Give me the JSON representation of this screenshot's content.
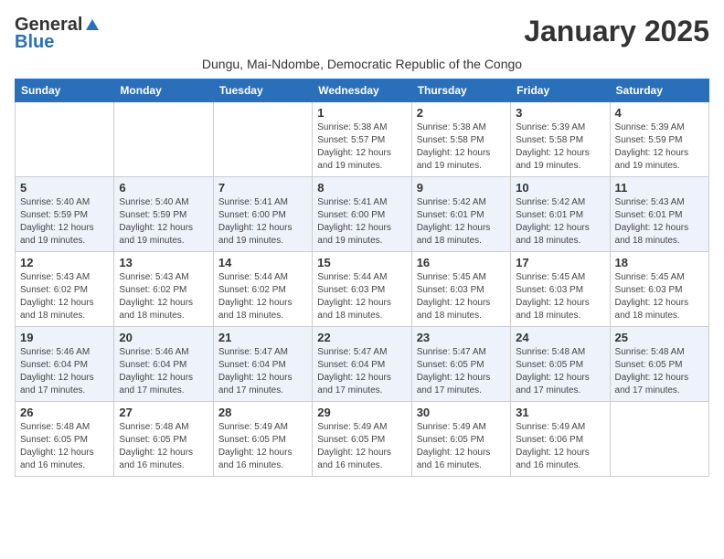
{
  "logo": {
    "line1": "General",
    "line2": "Blue"
  },
  "title": "January 2025",
  "subtitle": "Dungu, Mai-Ndombe, Democratic Republic of the Congo",
  "days_of_week": [
    "Sunday",
    "Monday",
    "Tuesday",
    "Wednesday",
    "Thursday",
    "Friday",
    "Saturday"
  ],
  "weeks": [
    [
      {
        "day": "",
        "info": ""
      },
      {
        "day": "",
        "info": ""
      },
      {
        "day": "",
        "info": ""
      },
      {
        "day": "1",
        "info": "Sunrise: 5:38 AM\nSunset: 5:57 PM\nDaylight: 12 hours and 19 minutes."
      },
      {
        "day": "2",
        "info": "Sunrise: 5:38 AM\nSunset: 5:58 PM\nDaylight: 12 hours and 19 minutes."
      },
      {
        "day": "3",
        "info": "Sunrise: 5:39 AM\nSunset: 5:58 PM\nDaylight: 12 hours and 19 minutes."
      },
      {
        "day": "4",
        "info": "Sunrise: 5:39 AM\nSunset: 5:59 PM\nDaylight: 12 hours and 19 minutes."
      }
    ],
    [
      {
        "day": "5",
        "info": "Sunrise: 5:40 AM\nSunset: 5:59 PM\nDaylight: 12 hours and 19 minutes."
      },
      {
        "day": "6",
        "info": "Sunrise: 5:40 AM\nSunset: 5:59 PM\nDaylight: 12 hours and 19 minutes."
      },
      {
        "day": "7",
        "info": "Sunrise: 5:41 AM\nSunset: 6:00 PM\nDaylight: 12 hours and 19 minutes."
      },
      {
        "day": "8",
        "info": "Sunrise: 5:41 AM\nSunset: 6:00 PM\nDaylight: 12 hours and 19 minutes."
      },
      {
        "day": "9",
        "info": "Sunrise: 5:42 AM\nSunset: 6:01 PM\nDaylight: 12 hours and 18 minutes."
      },
      {
        "day": "10",
        "info": "Sunrise: 5:42 AM\nSunset: 6:01 PM\nDaylight: 12 hours and 18 minutes."
      },
      {
        "day": "11",
        "info": "Sunrise: 5:43 AM\nSunset: 6:01 PM\nDaylight: 12 hours and 18 minutes."
      }
    ],
    [
      {
        "day": "12",
        "info": "Sunrise: 5:43 AM\nSunset: 6:02 PM\nDaylight: 12 hours and 18 minutes."
      },
      {
        "day": "13",
        "info": "Sunrise: 5:43 AM\nSunset: 6:02 PM\nDaylight: 12 hours and 18 minutes."
      },
      {
        "day": "14",
        "info": "Sunrise: 5:44 AM\nSunset: 6:02 PM\nDaylight: 12 hours and 18 minutes."
      },
      {
        "day": "15",
        "info": "Sunrise: 5:44 AM\nSunset: 6:03 PM\nDaylight: 12 hours and 18 minutes."
      },
      {
        "day": "16",
        "info": "Sunrise: 5:45 AM\nSunset: 6:03 PM\nDaylight: 12 hours and 18 minutes."
      },
      {
        "day": "17",
        "info": "Sunrise: 5:45 AM\nSunset: 6:03 PM\nDaylight: 12 hours and 18 minutes."
      },
      {
        "day": "18",
        "info": "Sunrise: 5:45 AM\nSunset: 6:03 PM\nDaylight: 12 hours and 18 minutes."
      }
    ],
    [
      {
        "day": "19",
        "info": "Sunrise: 5:46 AM\nSunset: 6:04 PM\nDaylight: 12 hours and 17 minutes."
      },
      {
        "day": "20",
        "info": "Sunrise: 5:46 AM\nSunset: 6:04 PM\nDaylight: 12 hours and 17 minutes."
      },
      {
        "day": "21",
        "info": "Sunrise: 5:47 AM\nSunset: 6:04 PM\nDaylight: 12 hours and 17 minutes."
      },
      {
        "day": "22",
        "info": "Sunrise: 5:47 AM\nSunset: 6:04 PM\nDaylight: 12 hours and 17 minutes."
      },
      {
        "day": "23",
        "info": "Sunrise: 5:47 AM\nSunset: 6:05 PM\nDaylight: 12 hours and 17 minutes."
      },
      {
        "day": "24",
        "info": "Sunrise: 5:48 AM\nSunset: 6:05 PM\nDaylight: 12 hours and 17 minutes."
      },
      {
        "day": "25",
        "info": "Sunrise: 5:48 AM\nSunset: 6:05 PM\nDaylight: 12 hours and 17 minutes."
      }
    ],
    [
      {
        "day": "26",
        "info": "Sunrise: 5:48 AM\nSunset: 6:05 PM\nDaylight: 12 hours and 16 minutes."
      },
      {
        "day": "27",
        "info": "Sunrise: 5:48 AM\nSunset: 6:05 PM\nDaylight: 12 hours and 16 minutes."
      },
      {
        "day": "28",
        "info": "Sunrise: 5:49 AM\nSunset: 6:05 PM\nDaylight: 12 hours and 16 minutes."
      },
      {
        "day": "29",
        "info": "Sunrise: 5:49 AM\nSunset: 6:05 PM\nDaylight: 12 hours and 16 minutes."
      },
      {
        "day": "30",
        "info": "Sunrise: 5:49 AM\nSunset: 6:05 PM\nDaylight: 12 hours and 16 minutes."
      },
      {
        "day": "31",
        "info": "Sunrise: 5:49 AM\nSunset: 6:06 PM\nDaylight: 12 hours and 16 minutes."
      },
      {
        "day": "",
        "info": ""
      }
    ]
  ]
}
